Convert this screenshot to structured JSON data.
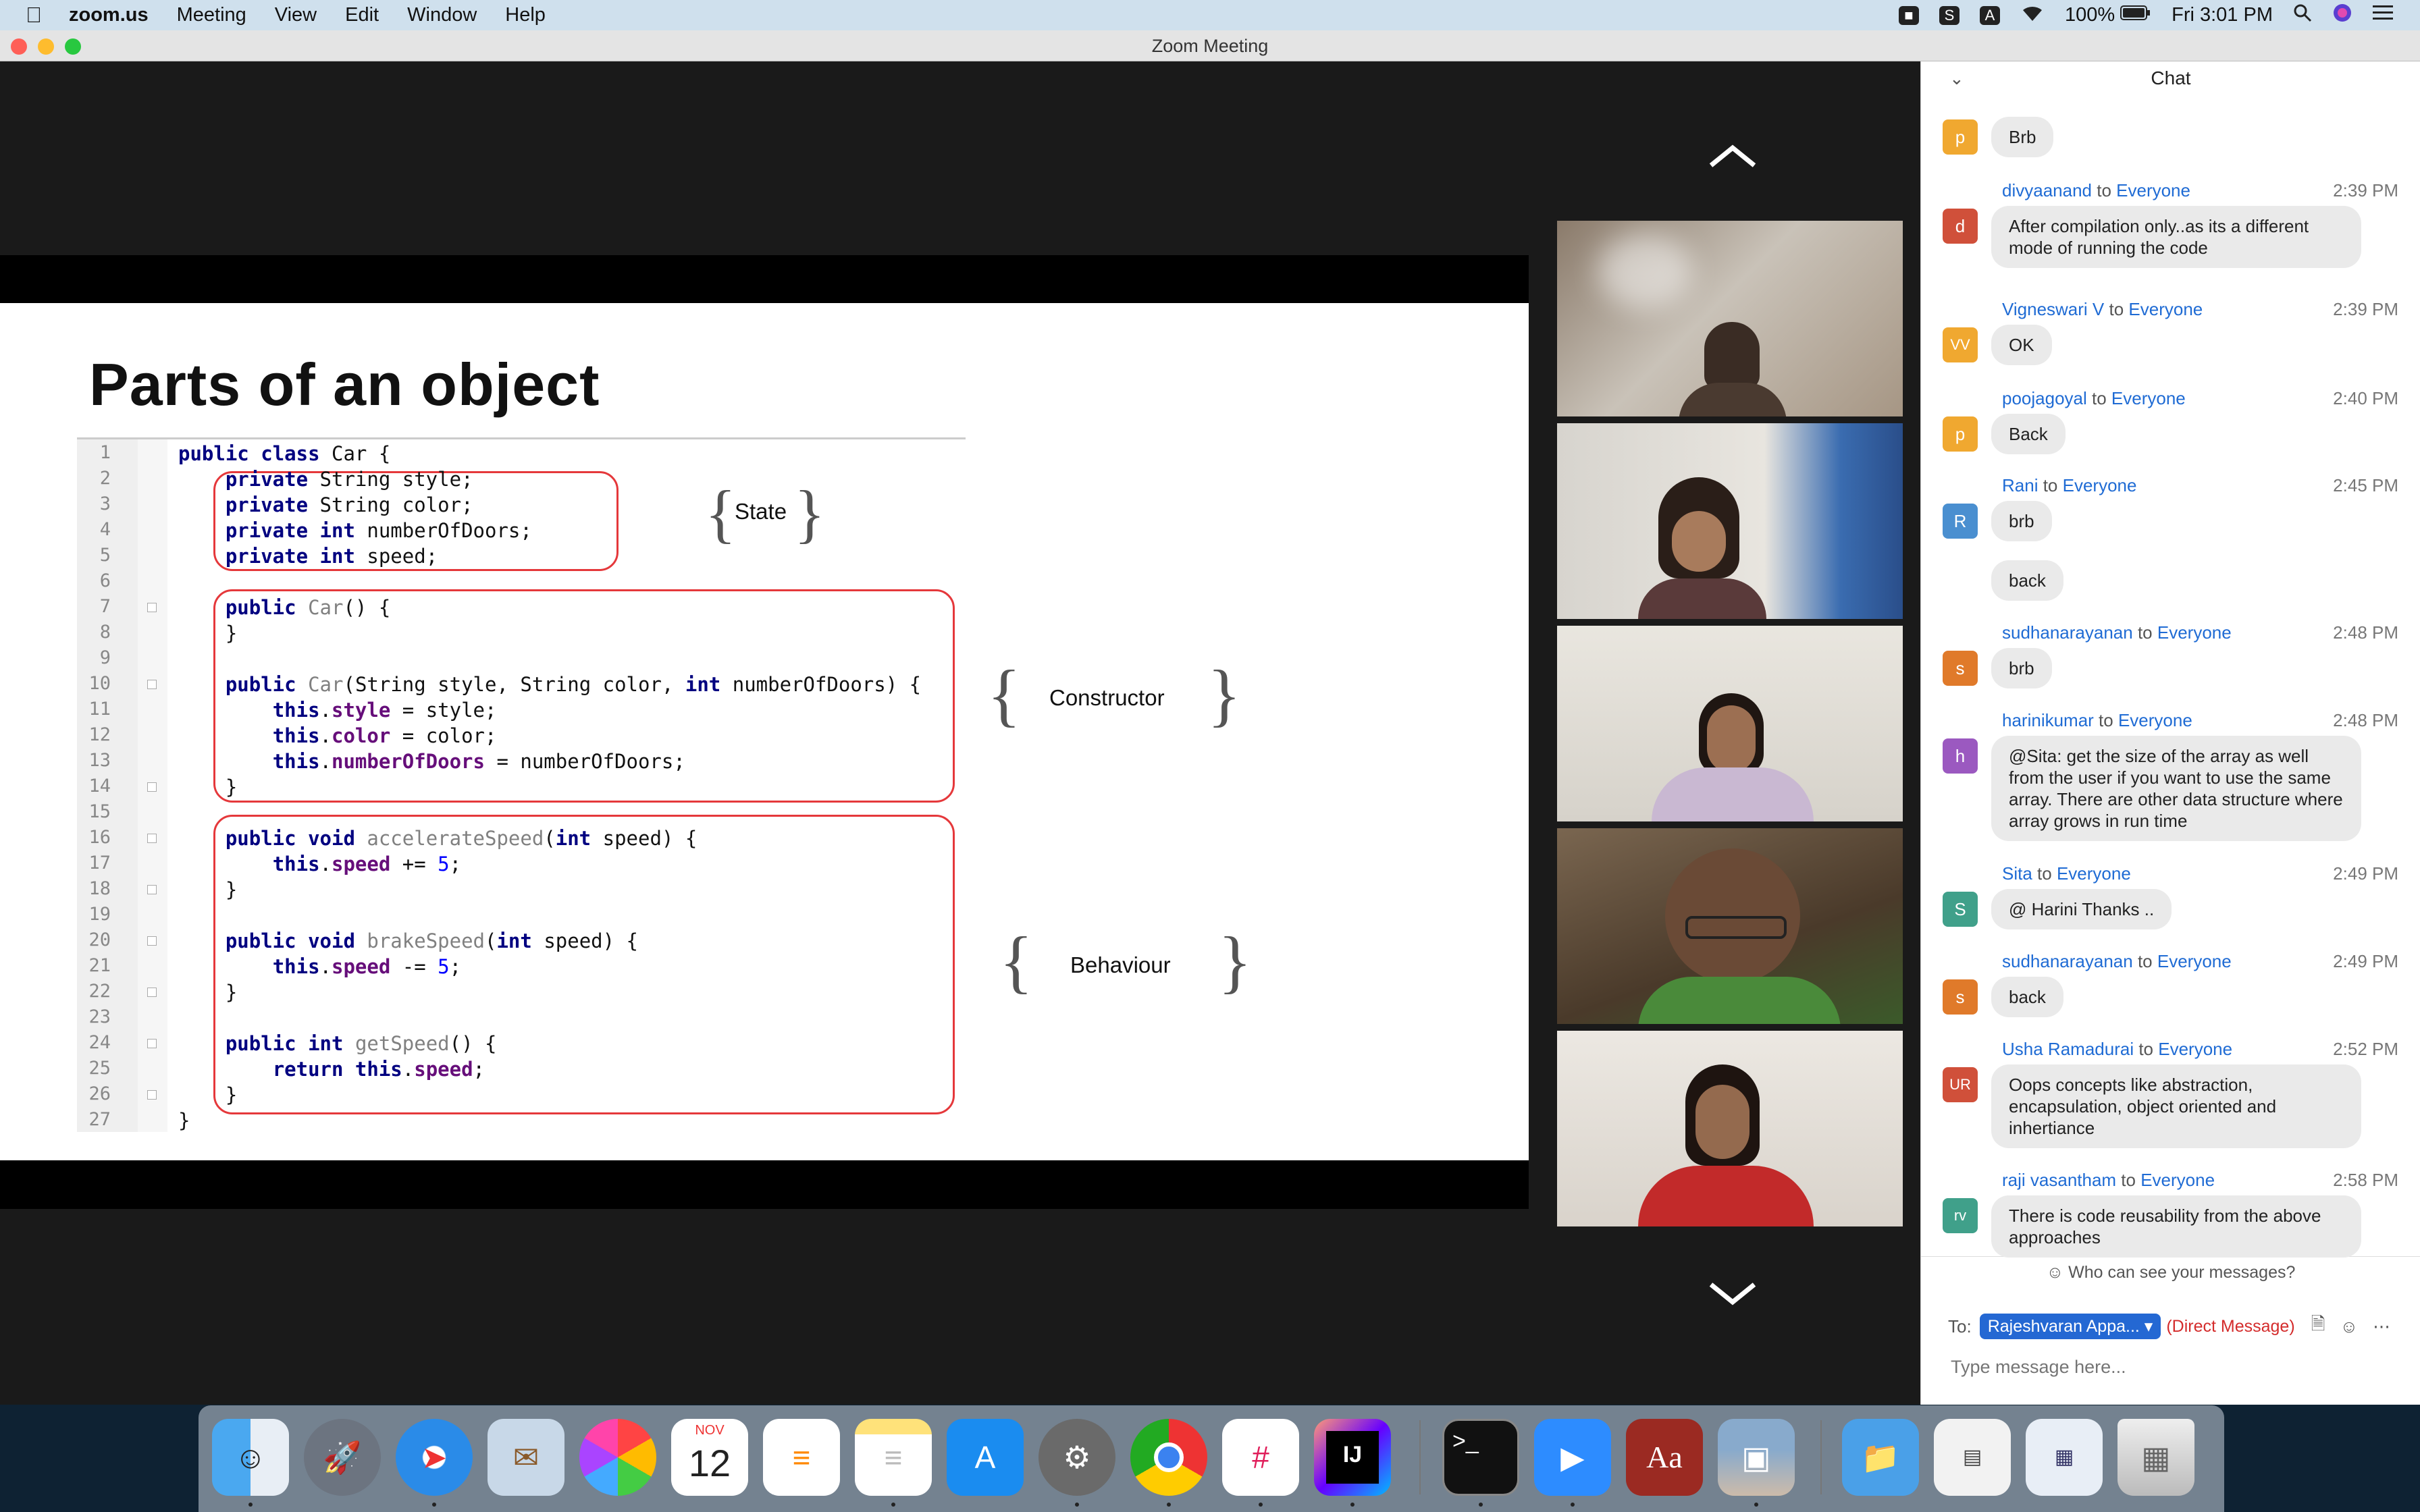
{
  "menubar": {
    "app_name": "zoom.us",
    "menus": [
      "Meeting",
      "View",
      "Edit",
      "Window",
      "Help"
    ],
    "battery": "100%",
    "clock": "Fri 3:01 PM"
  },
  "window": {
    "title": "Zoom Meeting"
  },
  "slide": {
    "title": "Parts of an object",
    "labels": {
      "state": "State",
      "constructor": "Constructor",
      "behaviour": "Behaviour"
    },
    "code_lines": [
      "public class Car {",
      "    private String style;",
      "    private String color;",
      "    private int numberOfDoors;",
      "    private int speed;",
      "",
      "    public Car() {",
      "    }",
      "",
      "    public Car(String style, String color, int numberOfDoors) {",
      "        this.style = style;",
      "        this.color = color;",
      "        this.numberOfDoors = numberOfDoors;",
      "    }",
      "",
      "    public void accelerateSpeed(int speed) {",
      "        this.speed += 5;",
      "    }",
      "",
      "    public void brakeSpeed(int speed) {",
      "        this.speed -= 5;",
      "    }",
      "",
      "    public int getSpeed() {",
      "        return this.speed;",
      "    }",
      "}"
    ]
  },
  "chat": {
    "header": "Chat",
    "first_message": {
      "avatar": "p",
      "avatar_color": "#f0a830",
      "text": "Brb"
    },
    "messages": [
      {
        "avatar": "d",
        "avatar_color": "#d0503a",
        "sender": "divyaanand",
        "to_word": "to",
        "recipient": "Everyone",
        "time": "2:39 PM",
        "texts": [
          "After compilation only..as its a different mode of running the code"
        ]
      },
      {
        "avatar": "VV",
        "avatar_color": "#f0a830",
        "sender": "Vigneswari V",
        "to_word": "to",
        "recipient": "Everyone",
        "time": "2:39 PM",
        "texts": [
          "OK"
        ]
      },
      {
        "avatar": "p",
        "avatar_color": "#f0a830",
        "sender": "poojagoyal",
        "to_word": "to",
        "recipient": "Everyone",
        "time": "2:40 PM",
        "texts": [
          "Back"
        ]
      },
      {
        "avatar": "R",
        "avatar_color": "#4a8fd0",
        "sender": "Rani",
        "to_word": "to",
        "recipient": "Everyone",
        "time": "2:45 PM",
        "texts": [
          "brb",
          "back"
        ]
      },
      {
        "avatar": "s",
        "avatar_color": "#e07a2a",
        "sender": "sudhanarayanan",
        "to_word": "to",
        "recipient": "Everyone",
        "time": "2:48 PM",
        "texts": [
          "brb"
        ]
      },
      {
        "avatar": "h",
        "avatar_color": "#9b59c0",
        "sender": "harinikumar",
        "to_word": "to",
        "recipient": "Everyone",
        "time": "2:48 PM",
        "texts": [
          "@Sita: get the size of the array as well from the user if you want to use the same array. There are other data structure where array grows in run time"
        ]
      },
      {
        "avatar": "S",
        "avatar_color": "#40a08a",
        "sender": "Sita",
        "to_word": "to",
        "recipient": "Everyone",
        "time": "2:49 PM",
        "texts": [
          "@ Harini Thanks .."
        ]
      },
      {
        "avatar": "s",
        "avatar_color": "#e07a2a",
        "sender": "sudhanarayanan",
        "to_word": "to",
        "recipient": "Everyone",
        "time": "2:49 PM",
        "texts": [
          "back"
        ]
      },
      {
        "avatar": "UR",
        "avatar_color": "#d0503a",
        "sender": "Usha Ramadurai",
        "to_word": "to",
        "recipient": "Everyone",
        "time": "2:52 PM",
        "texts": [
          "Oops concepts like abstraction, encapsulation, object oriented and inhertiance"
        ]
      },
      {
        "avatar": "rv",
        "avatar_color": "#40a08a",
        "sender": "raji vasantham",
        "to_word": "to",
        "recipient": "Everyone",
        "time": "2:58 PM",
        "texts": [
          "There is code reusability from the above approaches"
        ]
      }
    ],
    "privacy_note": "Who can see your messages?",
    "to_label": "To:",
    "to_value": "Rajeshvaran Appa...",
    "direct_message": "(Direct Message)",
    "input_placeholder": "Type message here..."
  },
  "dock": {
    "calendar_month": "NOV",
    "calendar_day": "12",
    "intellij_label": "IJ",
    "terminal_label": ">_",
    "dictionary_label": "Aa"
  }
}
